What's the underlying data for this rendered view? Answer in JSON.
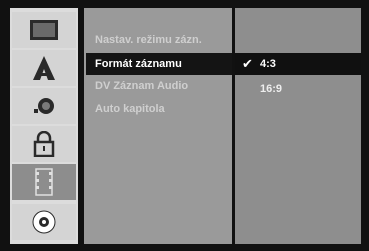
{
  "sidebar": {
    "items": [
      {
        "icon": "monitor-icon"
      },
      {
        "icon": "picture-icon"
      },
      {
        "icon": "audio-icon"
      },
      {
        "icon": "lock-icon"
      },
      {
        "icon": "film-icon",
        "selected": true
      },
      {
        "icon": "disc-icon"
      }
    ]
  },
  "menu": {
    "items": [
      {
        "label": "Nastav. režimu zázn."
      },
      {
        "label": "Formát záznamu",
        "active": true
      },
      {
        "label": "DV Záznam Audio"
      },
      {
        "label": "Auto kapitola"
      }
    ]
  },
  "options": {
    "items": [
      {
        "label": "4:3",
        "selected": true,
        "check": "✔"
      },
      {
        "label": "16:9"
      }
    ]
  }
}
